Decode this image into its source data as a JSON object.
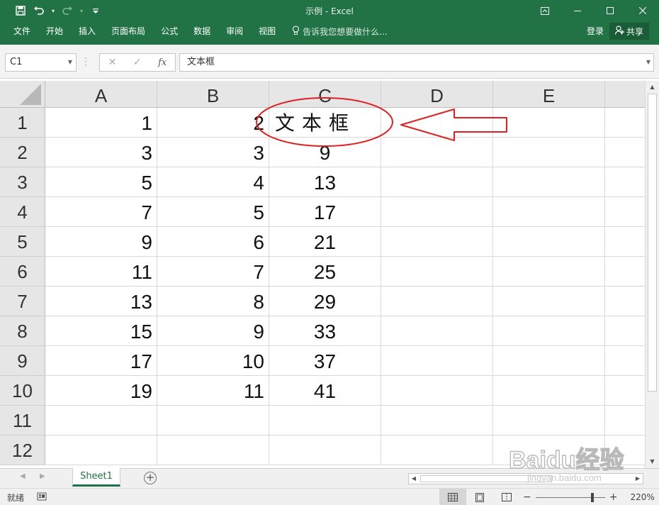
{
  "titlebar": {
    "title": "示例 - Excel"
  },
  "ribbon": {
    "tabs": [
      "文件",
      "开始",
      "插入",
      "页面布局",
      "公式",
      "数据",
      "审阅",
      "视图"
    ],
    "tell_me": "告诉我您想要做什么...",
    "login": "登录",
    "share": "共享"
  },
  "formula_bar": {
    "name_box": "C1",
    "content": "文本框"
  },
  "sheet": {
    "columns": [
      "A",
      "B",
      "C",
      "D",
      "E"
    ],
    "rows": [
      "1",
      "2",
      "3",
      "4",
      "5",
      "6",
      "7",
      "8",
      "9",
      "10",
      "11",
      "12"
    ],
    "data": [
      [
        "1",
        "2",
        "文本框",
        "",
        ""
      ],
      [
        "3",
        "3",
        "9",
        "",
        ""
      ],
      [
        "5",
        "4",
        "13",
        "",
        ""
      ],
      [
        "7",
        "5",
        "17",
        "",
        ""
      ],
      [
        "9",
        "6",
        "21",
        "",
        ""
      ],
      [
        "11",
        "7",
        "25",
        "",
        ""
      ],
      [
        "13",
        "8",
        "29",
        "",
        ""
      ],
      [
        "15",
        "9",
        "33",
        "",
        ""
      ],
      [
        "17",
        "10",
        "37",
        "",
        ""
      ],
      [
        "19",
        "11",
        "41",
        "",
        ""
      ],
      [
        "",
        "",
        "",
        "",
        ""
      ],
      [
        "",
        "",
        "",
        "",
        ""
      ]
    ]
  },
  "sheet_tabs": {
    "active": "Sheet1"
  },
  "status_bar": {
    "status": "就绪",
    "zoom": "220%"
  },
  "watermark": {
    "text": "Baidu经验",
    "url": "jingyan.baidu.com"
  },
  "colors": {
    "excel_green": "#217346",
    "annotation_red": "#e02020"
  }
}
